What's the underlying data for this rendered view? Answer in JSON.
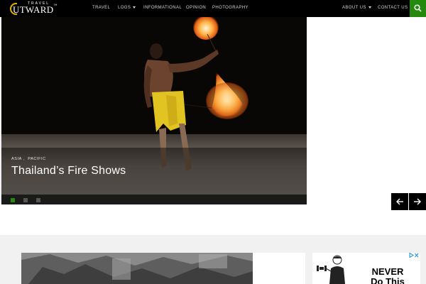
{
  "header": {
    "logo_small": "TRAVEL",
    "logo_main": "UTWARD",
    "logo_tm": "™",
    "nav": [
      {
        "label": "TRAVEL",
        "has_menu": false
      },
      {
        "label": "LOGS",
        "has_menu": true
      },
      {
        "label": "INFORMATIONAL",
        "has_menu": false
      },
      {
        "label": "OPINION",
        "has_menu": false
      },
      {
        "label": "PHOTOGRAPHY",
        "has_menu": false
      },
      {
        "label": "ABOUT US",
        "has_menu": true
      },
      {
        "label": "CONTACT US",
        "has_menu": false
      }
    ],
    "search_icon": "search-icon",
    "accent_color": "#24890d"
  },
  "hero": {
    "categories": [
      "ASIA",
      "PACIFIC"
    ],
    "title": "Thailand’s Fire Shows",
    "slide_count": 3,
    "active_slide": 1,
    "prev_icon": "arrow-left-icon",
    "next_icon": "arrow-right-icon"
  },
  "ad": {
    "text": "NEVER Do This",
    "choices_icon": "adchoices-icon"
  }
}
